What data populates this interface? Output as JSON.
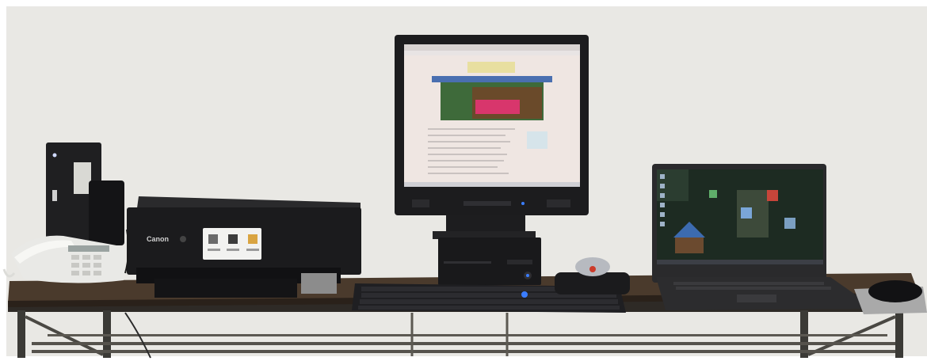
{
  "printer": {
    "brand_text": "Canon"
  },
  "colors": {
    "wall": "#e9e8e4",
    "table_top": "#4a3a2c",
    "table_frame": "#3b3a36",
    "device_black": "#1b1b1d",
    "monitor_screen": "#efe6e2",
    "laptop_screen": "#1d2b22",
    "phone_white": "#e9e9e6",
    "blue_led": "#3a7dff",
    "mouse_pad": "#a9a9a9"
  },
  "icons": {
    "printer_touchscreen_icons": [
      "printer-icon",
      "document-icon",
      "copy-icon"
    ],
    "laptop_desktop_icons": "app-shortcut-icons"
  }
}
